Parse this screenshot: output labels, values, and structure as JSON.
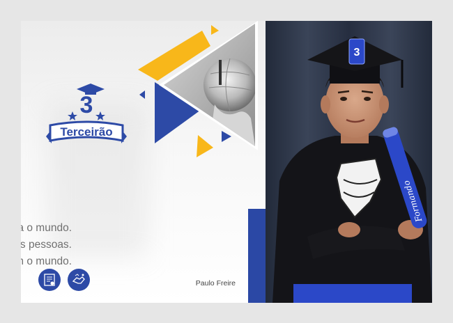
{
  "brand": {
    "number": "3",
    "name": "Terceirão"
  },
  "quote": {
    "lines": [
      "Educação não muda o mundo.",
      "Educação muda as pessoas.",
      "Pessoas mudam o mundo."
    ],
    "author": "Paulo Freire"
  },
  "icons": [
    "diploma-icon",
    "handshake-icon"
  ],
  "cap_badge": "3",
  "scroll_text": "Formando",
  "colors": {
    "brand_blue": "#2d4aa6",
    "accent_yellow": "#f8b71a",
    "background": "#e6e6e6"
  }
}
